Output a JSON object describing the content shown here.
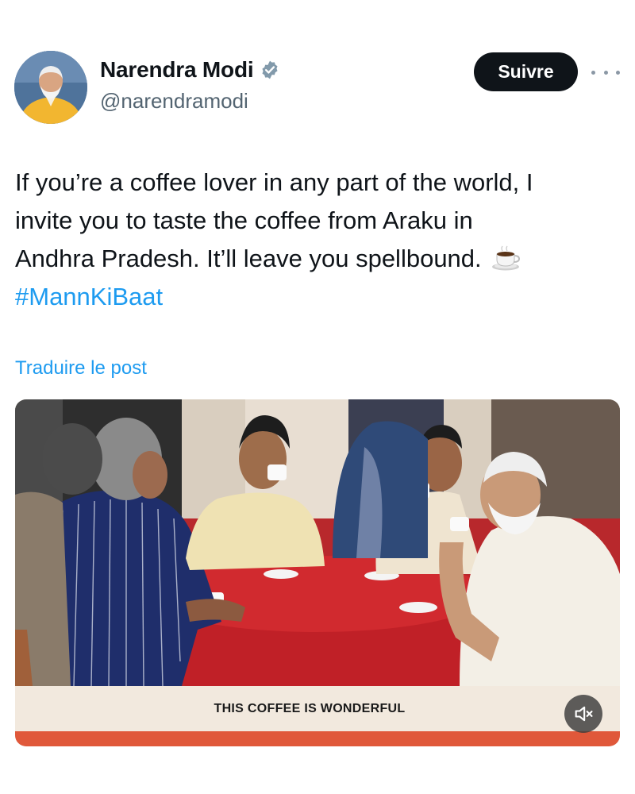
{
  "author": {
    "display_name": "Narendra Modi",
    "handle": "@narendramodi",
    "avatar_icon": "profile-photo",
    "verified_icon": "verified-badge-icon",
    "verified_color": "#829aab"
  },
  "actions": {
    "follow_label": "Suivre",
    "more_icon": "more-options-icon"
  },
  "post": {
    "text_line_1": "If you’re a coffee lover in any part of the world, I",
    "text_line_2": "invite you to taste the coffee from Araku in",
    "text_line_3": "Andhra Pradesh. It’ll leave you spellbound.",
    "emoji": "☕",
    "hashtag": "#MannKiBaat",
    "translate_label": "Traduire le post"
  },
  "media": {
    "type": "video",
    "caption": "THIS COFFEE IS WONDERFUL",
    "mute_icon": "muted-speaker-icon"
  },
  "colors": {
    "link": "#1d9bf0",
    "text": "#0f1419",
    "secondary": "#536471",
    "caption_accent": "#e0583a"
  }
}
